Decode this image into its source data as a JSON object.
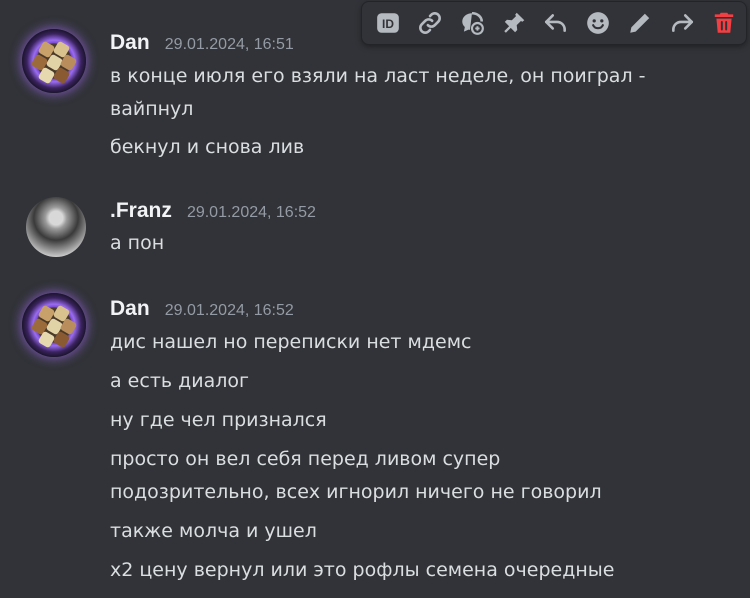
{
  "toolbar": {
    "actions": [
      {
        "id": "copy-id",
        "icon": "id-icon"
      },
      {
        "id": "copy-link",
        "icon": "link-icon"
      },
      {
        "id": "reply-thread",
        "icon": "thread-icon"
      },
      {
        "id": "pin",
        "icon": "pin-icon"
      },
      {
        "id": "reply",
        "icon": "reply-icon"
      },
      {
        "id": "react",
        "icon": "emoji-icon"
      },
      {
        "id": "edit",
        "icon": "pencil-icon"
      },
      {
        "id": "forward",
        "icon": "forward-icon"
      },
      {
        "id": "delete",
        "icon": "trash-icon",
        "color": "#f23f43"
      }
    ],
    "id_badge_text": "ID"
  },
  "messages": [
    {
      "author": "Dan",
      "timestamp": "29.01.2024, 16:51",
      "lines": [
        "в конце июля его взяли на ласт неделе, он поиграл -",
        "вайпнул",
        "бекнул и снова лив"
      ]
    },
    {
      "author": ".Franz",
      "timestamp": "29.01.2024, 16:52",
      "lines": [
        "а пон"
      ]
    },
    {
      "author": "Dan",
      "timestamp": "29.01.2024, 16:52",
      "lines": [
        "дис нашел но переписки нет мдемс",
        "а есть диалог",
        "ну где чел признался",
        "просто он вел себя перед ливом супер",
        "подозрительно, всех игнорил ничего не говорил",
        "также молча и ушел",
        "х2 цену вернул или это рофлы семена очередные"
      ]
    }
  ],
  "colors": {
    "background": "#313338",
    "text": "#dbdee1",
    "username": "#f2f3f5",
    "timestamp": "#949ba4",
    "danger": "#f23f43"
  }
}
